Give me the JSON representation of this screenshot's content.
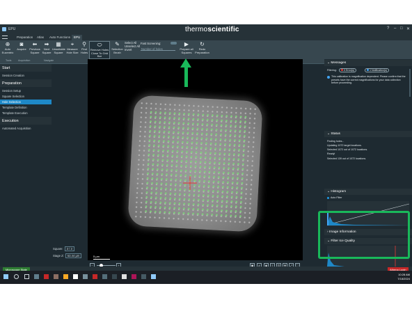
{
  "title_bar": {
    "app_name": "EPU",
    "brand_light": "thermo",
    "brand_bold": "scientific"
  },
  "tabs": [
    "Preparation",
    "Atlas",
    "Auto Functions",
    "EPU"
  ],
  "active_tab": "EPU",
  "ribbon": {
    "buttons": [
      {
        "label": "Auto Eucentric",
        "icon": "eucentric-icon"
      },
      {
        "label": "Acquire",
        "icon": "camera-icon"
      },
      {
        "label": "Previous Square",
        "icon": "arrow-left-icon"
      },
      {
        "label": "Next Square",
        "icon": "arrow-right-icon"
      },
      {
        "label": "Unsuitable Square",
        "icon": "unsuitable-icon"
      },
      {
        "label": "Measure Hole Size",
        "icon": "measure-icon"
      },
      {
        "label": "Find Holes",
        "icon": "search-icon"
      },
      {
        "label": "Remove Holes Close To Grid Bar",
        "icon": "remove-holes-icon"
      },
      {
        "label": "Selection Brush",
        "icon": "brush-icon"
      },
      {
        "label": "Prepare all Squares",
        "icon": "play-icon"
      },
      {
        "label": "Redo Preparation",
        "icon": "redo-icon"
      }
    ],
    "select_all": "Select All",
    "unselect_all": "Unselect All",
    "invert": "Invert",
    "fast_screening": "Fast Screening:",
    "number_of_holes": "Number of holes",
    "groups": [
      "Tools",
      "Acquisition",
      "Navigate",
      "Selection",
      "Filter",
      "Size Screening",
      "Automated Preparation"
    ]
  },
  "left_panel": {
    "sections": [
      {
        "title": "Start",
        "items": [
          "Session Creation"
        ]
      },
      {
        "title": "Preparation",
        "items": [
          "Session Setup",
          "Square Selection",
          "Hole Selection",
          "Template Definition",
          "Template Execution"
        ]
      },
      {
        "title": "Execution",
        "items": [
          "Automated Acquisition"
        ]
      }
    ],
    "active_item": "Hole Selection",
    "square_label": "Square:",
    "square_value": "3 / 3",
    "stage_label": "Stage Z:",
    "stage_value": "53.44 µm"
  },
  "viewer": {
    "scale_bar": "5 µm",
    "zoom_level": 0.15
  },
  "right_panel": {
    "messages": {
      "title": "Messages",
      "filtering_label": "Filtering:",
      "errors": "0 Error(s)",
      "notifications": "1 Notification(s)",
      "message": "This calibration is magnification dependent. Please confirm that the presets have the correct magnifications for your data collection before proceeding."
    },
    "status": {
      "title": "Status",
      "lines": [
        "Finding holes...",
        "Updating 1072 target locations.",
        "Selected 1072 out of 1072 locations.",
        "Ready!",
        "Selected 139 out of 1072 locations."
      ]
    },
    "histogram": {
      "title": "Histogram",
      "auto_filter": "Auto Filter"
    },
    "image_information": {
      "title": "Image Information"
    },
    "filter_ice_quality": {
      "title": "Filter Ice Quality",
      "min_value": "0",
      "max_value": "1,752",
      "apply": "Apply",
      "status": "Status: Ready"
    }
  },
  "status_bar": {
    "microscope_state": "Microscope State",
    "user_badge": "Athena Login"
  },
  "taskbar": {
    "time": "10:28 AM",
    "date": "7/18/2024"
  },
  "colors": {
    "accent": "#1e88c7",
    "highlight": "#19b85a",
    "hole_green": "#7ed07a",
    "crosshair": "#e53935"
  }
}
